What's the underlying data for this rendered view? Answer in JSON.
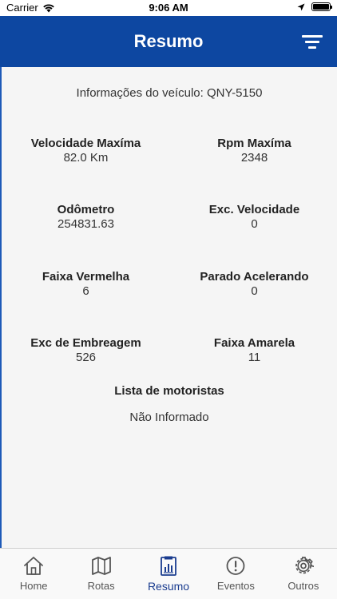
{
  "status_bar": {
    "carrier": "Carrier",
    "time": "9:06 AM",
    "battery_level": 1.0
  },
  "header": {
    "title": "Resumo"
  },
  "vehicle": {
    "info": "Informações do veículo: QNY-5150"
  },
  "stats": [
    {
      "label": "Velocidade Maxíma",
      "value": "82.0 Km"
    },
    {
      "label": "Rpm Maxíma",
      "value": "2348"
    },
    {
      "label": "Odômetro",
      "value": "254831.63"
    },
    {
      "label": "Exc. Velocidade",
      "value": "0"
    },
    {
      "label": "Faixa Vermelha",
      "value": "6"
    },
    {
      "label": "Parado Acelerando",
      "value": "0"
    },
    {
      "label": "Exc de Embreagem",
      "value": "526"
    },
    {
      "label": "Faixa Amarela",
      "value": "11"
    }
  ],
  "drivers": {
    "title": "Lista de motoristas",
    "value": "Não Informado"
  },
  "tabs": [
    {
      "label": "Home",
      "icon": "home-icon",
      "active": false
    },
    {
      "label": "Rotas",
      "icon": "map-icon",
      "active": false
    },
    {
      "label": "Resumo",
      "icon": "clipboard-icon",
      "active": true
    },
    {
      "label": "Eventos",
      "icon": "alert-icon",
      "active": false
    },
    {
      "label": "Outros",
      "icon": "gear-icon",
      "active": false
    }
  ],
  "colors": {
    "primary": "#0d47a1",
    "active_tab": "#1a3c8f",
    "background": "#f5f5f5"
  }
}
